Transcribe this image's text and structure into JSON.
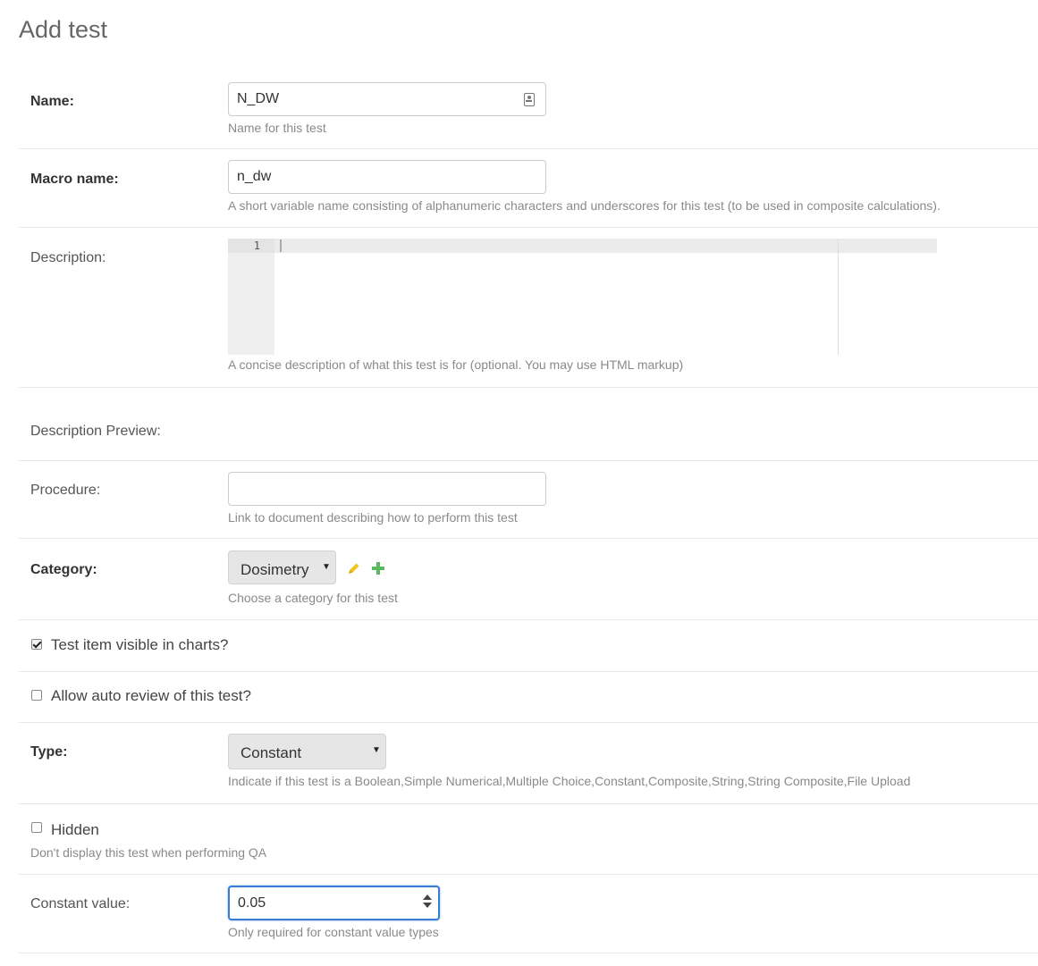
{
  "page": {
    "title": "Add test"
  },
  "fields": {
    "name": {
      "label": "Name:",
      "value": "N_DW",
      "help": "Name for this test"
    },
    "macro_name": {
      "label": "Macro name:",
      "value": "n_dw",
      "help": "A short variable name consisting of alphanumeric characters and underscores for this test (to be used in composite calculations)."
    },
    "description": {
      "label": "Description:",
      "line_number": "1",
      "value": "",
      "help": "A concise description of what this test is for (optional. You may use HTML markup)"
    },
    "description_preview": {
      "label": "Description Preview:"
    },
    "procedure": {
      "label": "Procedure:",
      "value": "",
      "help": "Link to document describing how to perform this test"
    },
    "category": {
      "label": "Category:",
      "selected": "Dosimetry",
      "help": "Choose a category for this test"
    },
    "chart_visible": {
      "label": "Test item visible in charts?",
      "checked": true
    },
    "auto_review": {
      "label": "Allow auto review of this test?",
      "checked": false
    },
    "type": {
      "label": "Type:",
      "selected": "Constant",
      "help": "Indicate if this test is a Boolean,Simple Numerical,Multiple Choice,Constant,Composite,String,String Composite,File Upload"
    },
    "hidden": {
      "label": "Hidden",
      "checked": false,
      "help": "Don't display this test when performing QA"
    },
    "constant_value": {
      "label": "Constant value:",
      "value": "0.05",
      "help": "Only required for constant value types"
    }
  },
  "icons": {
    "contact_card": "contact-card-icon",
    "edit": "pencil-icon",
    "add": "plus-icon",
    "dropdown": "caret-down-icon",
    "spinner": "spinner-arrows-icon"
  },
  "colors": {
    "edit_icon": "#f0c419",
    "add_icon": "#5cb85c",
    "focus_border": "#3a7bd5"
  }
}
